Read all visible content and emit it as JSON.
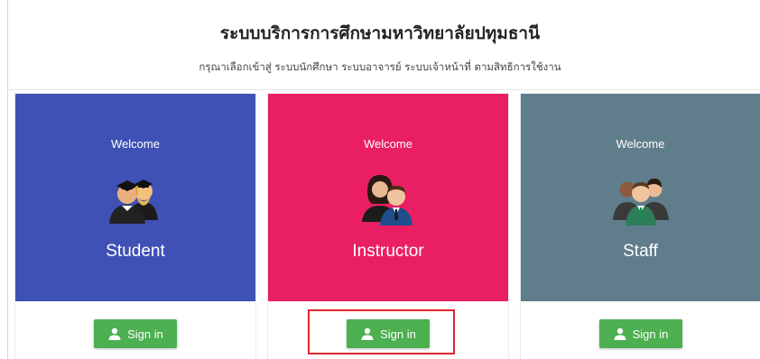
{
  "header": {
    "title": "ระบบบริการการศึกษามหาวิทยาลัยปทุมธานี",
    "subtitle": "กรุณาเลือกเข้าสู่ ระบบนักศึกษา ระบบอาจารย์ ระบบเจ้าหน้าที่ ตามสิทธิการใช้งาน"
  },
  "cards": [
    {
      "welcome": "Welcome",
      "role": "Student",
      "button_label": "Sign in",
      "color": "#3f51b5"
    },
    {
      "welcome": "Welcome",
      "role": "Instructor",
      "button_label": "Sign in",
      "color": "#e91e63"
    },
    {
      "welcome": "Welcome",
      "role": "Staff",
      "button_label": "Sign in",
      "color": "#607d8b"
    }
  ],
  "button_color": "#4caf50",
  "highlight_color": "#e0282e",
  "icons": {
    "student": "graduates-icon",
    "instructor": "instructor-icon",
    "staff": "staff-group-icon",
    "sign_in": "user-icon"
  }
}
